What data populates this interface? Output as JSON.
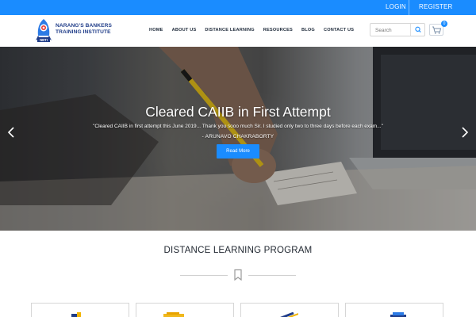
{
  "topbar": {
    "login": "LOGIN",
    "register": "REGISTER"
  },
  "brand": {
    "line1": "NARANG'S BANKERS",
    "line2": "TRAINING INSTITUTE",
    "logo_text": "NBTI"
  },
  "nav": [
    "HOME",
    "ABOUT US",
    "DISTANCE LEARNING",
    "RESOURCES",
    "BLOG",
    "CONTACT US"
  ],
  "search": {
    "placeholder": "Search",
    "icon": "search-icon"
  },
  "cart": {
    "icon": "cart-icon",
    "count": "0"
  },
  "hero": {
    "title": "Cleared CAIIB in First Attempt",
    "quote": "\"Cleared CAIIB in first attempt this June 2019... Thank you sooo much Sir. I studied only two to three days before each exam...\"",
    "author": "- ARUNAVO CHAKRABORTY",
    "button": "Read More",
    "prev_icon": "chevron-left-icon",
    "next_icon": "chevron-right-icon"
  },
  "section": {
    "title": "DISTANCE LEARNING PROGRAM",
    "icon": "bookmark-icon"
  },
  "colors": {
    "primary": "#1a8cff",
    "brand_navy": "#1f3c88",
    "heading": "#232a33"
  }
}
